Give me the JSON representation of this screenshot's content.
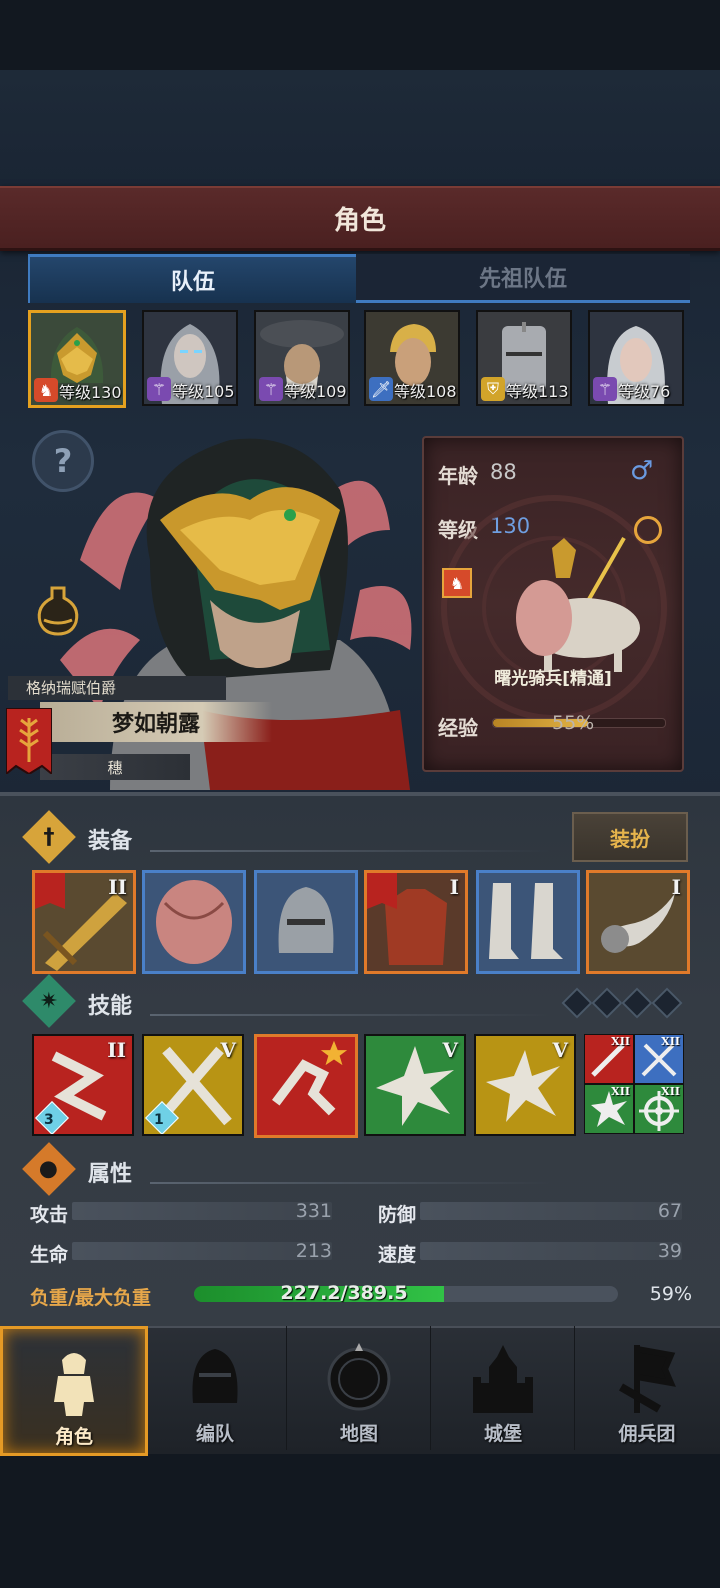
{
  "header": {
    "title": "角色"
  },
  "tabs": [
    {
      "label": "队伍"
    },
    {
      "label": "先祖队伍"
    }
  ],
  "roster": [
    {
      "level": "等级130",
      "class_icon": "cavalry-icon",
      "class_color": "#d64a2a",
      "selected": true
    },
    {
      "level": "等级105",
      "class_icon": "mage-staff-icon",
      "class_color": "#7a4ab0",
      "selected": false
    },
    {
      "level": "等级109",
      "class_icon": "mage-staff-icon",
      "class_color": "#7a4ab0",
      "selected": false
    },
    {
      "level": "等级108",
      "class_icon": "sword-icon",
      "class_color": "#3d6fc0",
      "selected": false
    },
    {
      "level": "等级113",
      "class_icon": "shield-icon",
      "class_color": "#d2a42a",
      "selected": false
    },
    {
      "level": "等级76",
      "class_icon": "mage-staff-icon",
      "class_color": "#7a4ab0",
      "selected": false
    }
  ],
  "hero": {
    "title": "格纳瑞赋伯爵",
    "name": "梦如朝露",
    "sub": "穗"
  },
  "info": {
    "age_label": "年龄",
    "age": "88",
    "gender_symbol": "♂",
    "level_label": "等级",
    "level": "130",
    "unit_name": "曙光骑兵[精通]",
    "exp_label": "经验",
    "exp_percent": "55%"
  },
  "equipment": {
    "title": "装备",
    "dress_button": "装扮",
    "slots": [
      {
        "name": "weapon",
        "tier": "II",
        "border": "#e07a2a"
      },
      {
        "name": "shield",
        "tier": "",
        "border": "#4a80c8"
      },
      {
        "name": "helmet",
        "tier": "",
        "border": "#4a80c8"
      },
      {
        "name": "armor",
        "tier": "I",
        "border": "#e07a2a"
      },
      {
        "name": "boots",
        "tier": "",
        "border": "#4a80c8"
      },
      {
        "name": "horn",
        "tier": "I",
        "border": "#e07a2a"
      }
    ]
  },
  "skills": {
    "title": "技能",
    "slots": [
      {
        "name": "skill-1",
        "tier": "II",
        "gem": "3",
        "color": "#b8231f"
      },
      {
        "name": "skill-2",
        "tier": "V",
        "gem": "1",
        "color": "#b89414"
      },
      {
        "name": "skill-3",
        "tier": "",
        "gem": "",
        "color": "#b8231f"
      },
      {
        "name": "skill-4",
        "tier": "V",
        "gem": "",
        "color": "#2e8a3c"
      },
      {
        "name": "skill-5",
        "tier": "V",
        "gem": "",
        "color": "#b89414"
      }
    ],
    "mini": [
      {
        "tier": "XII",
        "color": "#b8231f"
      },
      {
        "tier": "XII",
        "color": "#3d6fc0"
      },
      {
        "tier": "XII",
        "color": "#2e8a3c"
      },
      {
        "tier": "XII",
        "color": "#2e8a3c"
      }
    ]
  },
  "attributes": {
    "title": "属性",
    "attack_label": "攻击",
    "attack": "331",
    "defense_label": "防御",
    "defense": "67",
    "hp_label": "生命",
    "hp": "213",
    "speed_label": "速度",
    "speed": "39",
    "load_label": "负重/最大负重",
    "load_text": "227.2/389.5",
    "load_percent": "59%",
    "load_fraction": 0.59
  },
  "nav": [
    {
      "label": "角色",
      "active": true
    },
    {
      "label": "编队",
      "active": false
    },
    {
      "label": "地图",
      "active": false
    },
    {
      "label": "城堡",
      "active": false
    },
    {
      "label": "佣兵团",
      "active": false
    }
  ],
  "colors": {
    "accent_orange": "#e59a25",
    "tab_blue": "#3f7bc0",
    "load_green": "#31c246"
  }
}
